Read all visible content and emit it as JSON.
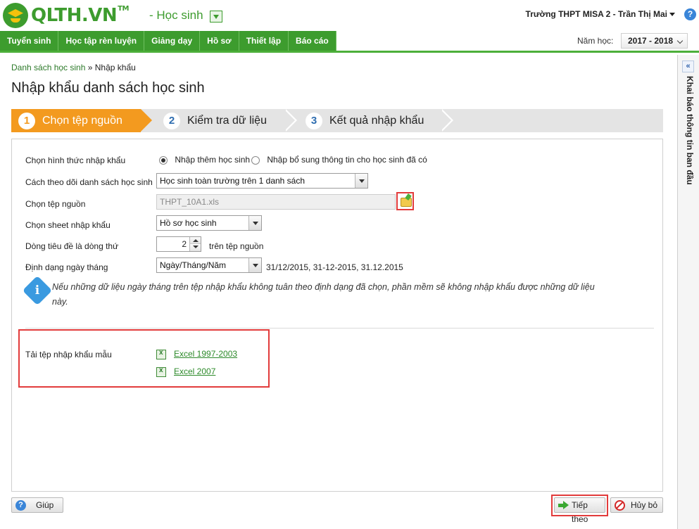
{
  "header": {
    "logo_text": "QLTH.VN",
    "logo_tm": "TM",
    "app_name": "- Học sinh",
    "user": "Trường THPT MISA 2 - Trần Thị Mai"
  },
  "nav": {
    "items": [
      "Tuyển sinh",
      "Học tập rèn luyện",
      "Giảng dạy",
      "Hồ sơ",
      "Thiết lập",
      "Báo cáo"
    ],
    "year_label": "Năm học:",
    "year_value": "2017 - 2018"
  },
  "breadcrumb": {
    "parent": "Danh sách học sinh",
    "separator": " » ",
    "current": "Nhập khẩu"
  },
  "page_title": "Nhập khẩu danh sách học sinh",
  "steps": [
    {
      "num": "1",
      "label": "Chọn tệp nguồn",
      "active": true
    },
    {
      "num": "2",
      "label": "Kiểm tra dữ liệu",
      "active": false
    },
    {
      "num": "3",
      "label": "Kết quả nhập khẩu",
      "active": false
    }
  ],
  "form": {
    "import_type_label": "Chọn hình thức nhập khẩu",
    "import_option_1": "Nhập thêm học sinh",
    "import_option_2": "Nhập bổ sung thông tin cho học sinh đã có",
    "tracking_label": "Cách theo dõi danh sách học sinh",
    "tracking_value": "Học sinh toàn trường trên 1 danh sách",
    "source_label": "Chọn tệp nguồn",
    "source_value": "THPT_10A1.xls",
    "sheet_label": "Chọn sheet nhập khẩu",
    "sheet_value": "Hồ sơ học sinh",
    "header_row_label": "Dòng tiêu đề là dòng thứ",
    "header_row_value": "2",
    "header_row_suffix": "trên tệp nguồn",
    "date_format_label": "Định dạng ngày tháng",
    "date_format_value": "Ngày/Tháng/Năm",
    "date_format_example": "31/12/2015, 31-12-2015, 31.12.2015",
    "note_line1": "Nếu những dữ liệu ngày tháng trên tệp nhập khẩu không tuân theo định dạng đã chọn, phần mềm sẽ không nhập khẩu được những dữ liệu",
    "note_line2": "này.",
    "template_label": "Tải tệp nhập khẩu mẫu",
    "template_links": [
      "Excel 1997-2003",
      "Excel 2007"
    ]
  },
  "buttons": {
    "help": "Giúp",
    "next": "Tiếp theo",
    "cancel": "Hủy bỏ"
  },
  "side_panel": {
    "title": "Khai báo thông tin ban đầu",
    "collapse_glyph": "«"
  },
  "colors": {
    "brand_green": "#3d9c2e",
    "step_active": "#f39a1f",
    "highlight_red": "#e23b3b"
  }
}
